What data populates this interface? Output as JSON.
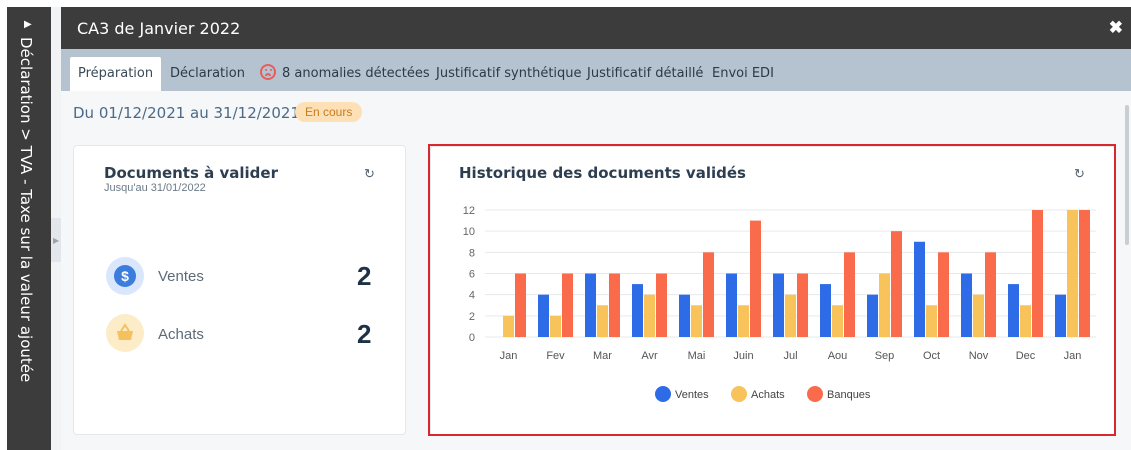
{
  "sidebar": {
    "breadcrumb": "Déclaration > TVA - Taxe sur la valeur ajoutée",
    "expand_icon": "triangle-right-icon"
  },
  "header": {
    "title": "CA3 de Janvier 2022",
    "close_icon": "close-icon"
  },
  "tabs": [
    {
      "label": "Préparation",
      "active": true
    },
    {
      "label": "Déclaration"
    },
    {
      "label": "8 anomalies détectées",
      "icon": "sad-face-icon"
    },
    {
      "label": "Justificatif synthétique"
    },
    {
      "label": "Justificatif détaillé"
    },
    {
      "label": "Envoi EDI"
    }
  ],
  "period": {
    "text": "Du 01/12/2021 au 31/12/2021",
    "status": "En cours"
  },
  "documents_card": {
    "title": "Documents à valider",
    "subtitle": "Jusqu'au 31/01/2022",
    "items": [
      {
        "label": "Ventes",
        "count": "2",
        "icon": "dollar-icon",
        "color": "#3b7ddd"
      },
      {
        "label": "Achats",
        "count": "2",
        "icon": "basket-icon",
        "color": "#f4c15d"
      }
    ]
  },
  "history_card": {
    "title": "Historique des documents validés"
  },
  "colors": {
    "ventes": "#2e6be6",
    "achats": "#f7c35a",
    "banques": "#fa6b4c",
    "highlight": "#d7282d"
  },
  "chart_data": {
    "type": "bar",
    "title": "Historique des documents validés",
    "categories": [
      "Jan",
      "Fev",
      "Mar",
      "Avr",
      "Mai",
      "Juin",
      "Jul",
      "Aou",
      "Sep",
      "Oct",
      "Nov",
      "Dec",
      "Jan"
    ],
    "series": [
      {
        "name": "Ventes",
        "values": [
          0,
          4,
          6,
          5,
          4,
          6,
          6,
          5,
          4,
          9,
          6,
          5,
          4
        ]
      },
      {
        "name": "Achats",
        "values": [
          2,
          2,
          3,
          4,
          3,
          3,
          4,
          3,
          6,
          3,
          4,
          3,
          12
        ]
      },
      {
        "name": "Banques",
        "values": [
          6,
          6,
          6,
          6,
          8,
          11,
          6,
          8,
          10,
          8,
          8,
          12,
          12
        ]
      }
    ],
    "ylim": [
      0,
      12
    ],
    "yticks": [
      "0",
      "2",
      "4",
      "6",
      "8",
      "10",
      "12"
    ],
    "grid": true,
    "legend": "bottom-center"
  }
}
